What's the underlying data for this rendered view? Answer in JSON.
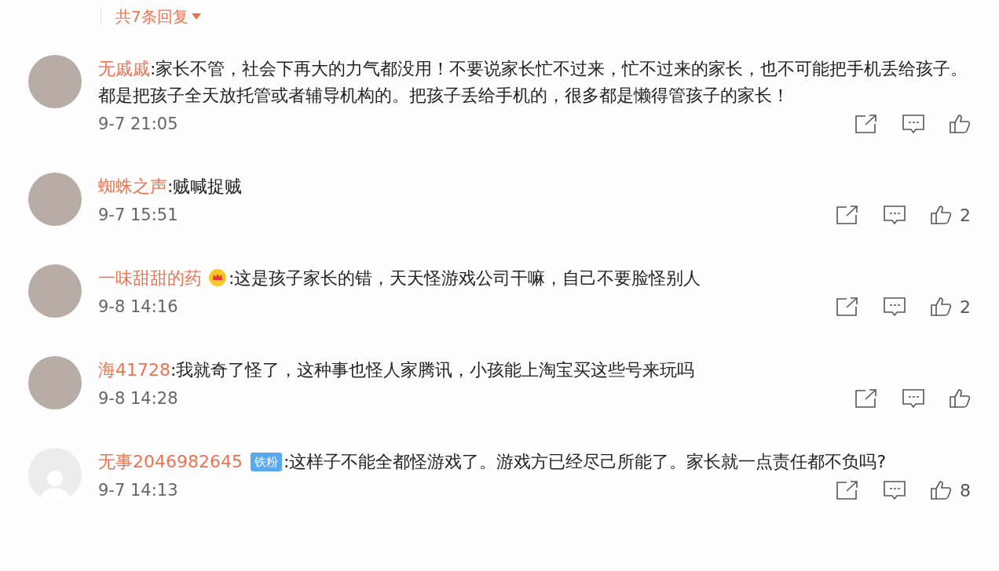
{
  "header": {
    "reply_count": "共7条回复"
  },
  "comments": [
    {
      "avatar": {
        "kind": "photo"
      },
      "user": "无戚戚",
      "text": ":家长不管，社会下再大的力气都没用！不要说家长忙不过来，忙不过来的家长，也不可能把手机丢给孩子。都是把孩子全天放托管或者辅导机构的。把孩子丢给手机的，很多都是懒得管孩子的家长！",
      "time": "9-7 21:05"
    },
    {
      "avatar": {
        "kind": "photo"
      },
      "user": "蜘蛛之声",
      "text": ":贼喊捉贼",
      "time": "9-7 15:51",
      "likes": "2"
    },
    {
      "avatar": {
        "kind": "photo"
      },
      "user": "一味甜甜的药",
      "badge": {
        "kind": "crown"
      },
      "text": ":这是孩子家长的错，天天怪游戏公司干嘛，自己不要脸怪别人",
      "time": "9-8 14:16",
      "likes": "2"
    },
    {
      "avatar": {
        "kind": "photo"
      },
      "user": "海41728",
      "text": ":我就奇了怪了，这种事也怪人家腾讯，小孩能上淘宝买这些号来玩吗",
      "time": "9-8 14:28"
    },
    {
      "avatar": {
        "kind": "default"
      },
      "user": "无事2046982645",
      "badge": {
        "kind": "tag",
        "label": "铁粉"
      },
      "text": ":这样子不能全都怪游戏了。游戏方已经尽己所能了。家长就一点责任都不负吗?",
      "time": "9-7 14:13",
      "likes": "8"
    }
  ]
}
